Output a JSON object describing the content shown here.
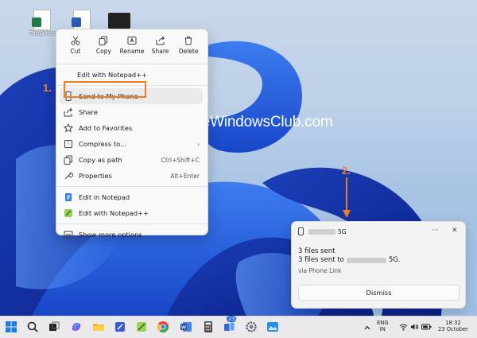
{
  "desktop": {
    "icons": [
      {
        "name": "excel-file",
        "label": "TheWindo"
      },
      {
        "name": "word-file",
        "label": ""
      },
      {
        "name": "thumbnail-file",
        "label": ""
      }
    ],
    "watermark": "TheWindowsClub.com"
  },
  "context_menu": {
    "quick_actions": [
      {
        "label": "Cut",
        "icon": "scissors-icon"
      },
      {
        "label": "Copy",
        "icon": "copy-icon"
      },
      {
        "label": "Rename",
        "icon": "rename-icon"
      },
      {
        "label": "Share",
        "icon": "share-icon"
      },
      {
        "label": "Delete",
        "icon": "trash-icon"
      }
    ],
    "edit_notepadpp_top": "Edit with Notepad++",
    "send_to_phone": "Send to My Phone",
    "share": "Share",
    "add_favorites": "Add to Favorites",
    "compress": "Compress to...",
    "copy_path": "Copy as path",
    "copy_path_shortcut": "Ctrl+Shift+C",
    "properties": "Properties",
    "properties_shortcut": "Alt+Enter",
    "edit_notepad": "Edit in Notepad",
    "edit_notepadpp": "Edit with Notepad++",
    "more_options": "Show more options"
  },
  "annotations": {
    "step1": "1.",
    "step2": "2.",
    "accent": "#f07c1e"
  },
  "notification": {
    "device_suffix": "5G",
    "more": "···",
    "close": "✕",
    "title": "3 files sent",
    "body_prefix": "3 files sent to",
    "body_suffix": "5G.",
    "source": "via Phone Link",
    "dismiss": "Dismiss"
  },
  "taskbar": {
    "badge": "23",
    "lang": "ENG",
    "region": "IN",
    "time": "18:32",
    "date": "23 October"
  }
}
